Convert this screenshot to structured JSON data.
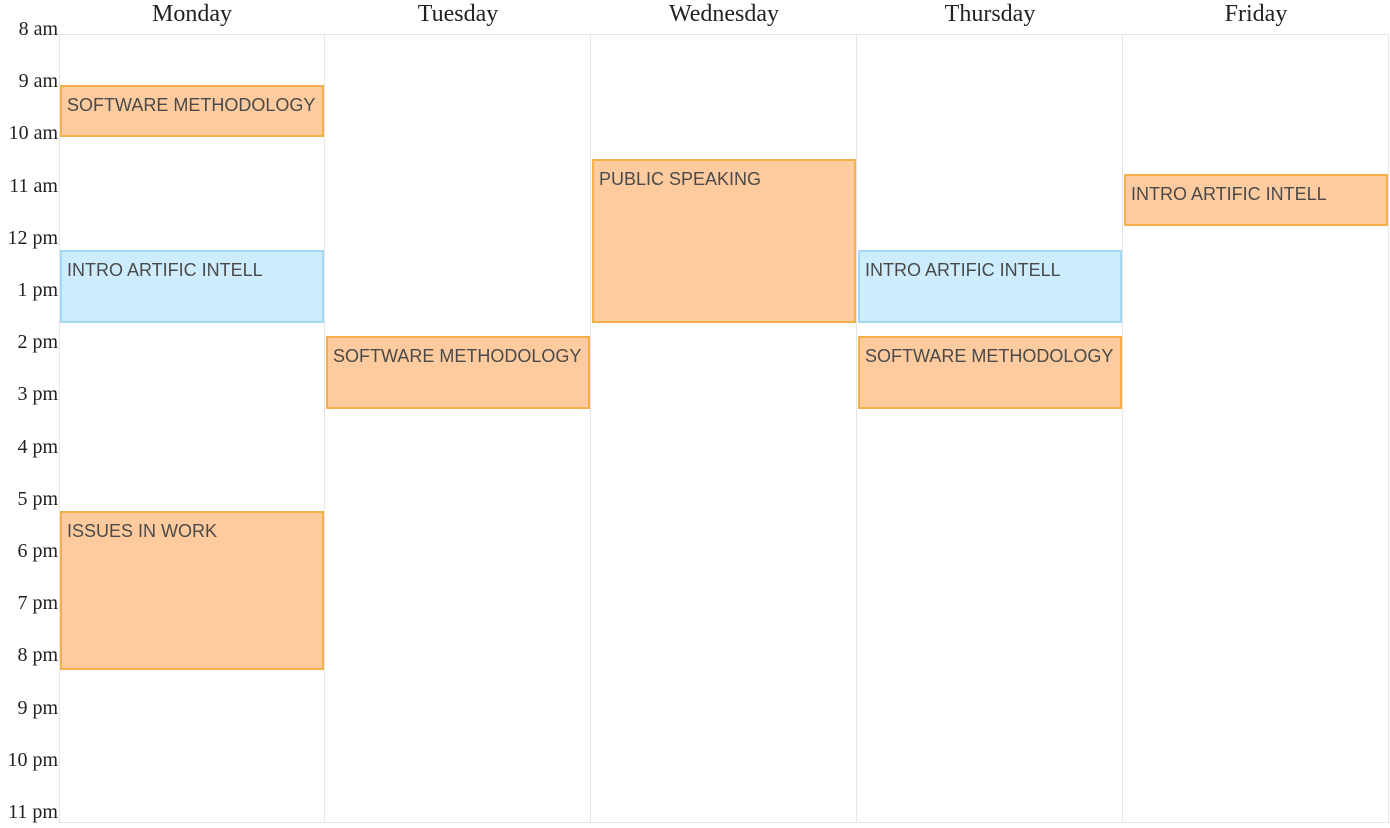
{
  "days": [
    "Monday",
    "Tuesday",
    "Wednesday",
    "Thursday",
    "Friday"
  ],
  "hours": [
    "8 am",
    "9 am",
    "10 am",
    "11 am",
    "12 pm",
    "1 pm",
    "2 pm",
    "3 pm",
    "4 pm",
    "5 pm",
    "6 pm",
    "7 pm",
    "8 pm",
    "9 pm",
    "10 pm",
    "11 pm"
  ],
  "colors": {
    "orange_fill": "#fdcb9d",
    "orange_border": "#f5b04a",
    "blue_fill": "#cdedfe",
    "blue_border": "#a5d8f5"
  },
  "events": [
    {
      "title": "SOFTWARE METHODOLOGY",
      "day": 0,
      "start": 9.0,
      "end": 10.0,
      "color": "orange"
    },
    {
      "title": "INTRO ARTIFIC INTELL",
      "day": 0,
      "start": 12.15,
      "end": 13.55,
      "color": "blue"
    },
    {
      "title": "ISSUES IN WORK",
      "day": 0,
      "start": 17.15,
      "end": 20.2,
      "color": "orange"
    },
    {
      "title": "SOFTWARE METHODOLOGY",
      "day": 1,
      "start": 13.8,
      "end": 15.2,
      "color": "orange"
    },
    {
      "title": "PUBLIC SPEAKING",
      "day": 2,
      "start": 10.42,
      "end": 13.55,
      "color": "orange"
    },
    {
      "title": "INTRO ARTIFIC INTELL",
      "day": 3,
      "start": 12.15,
      "end": 13.55,
      "color": "blue"
    },
    {
      "title": "SOFTWARE METHODOLOGY",
      "day": 3,
      "start": 13.8,
      "end": 15.2,
      "color": "orange"
    },
    {
      "title": "INTRO ARTIFIC INTELL",
      "day": 4,
      "start": 10.7,
      "end": 11.7,
      "color": "orange"
    }
  ]
}
